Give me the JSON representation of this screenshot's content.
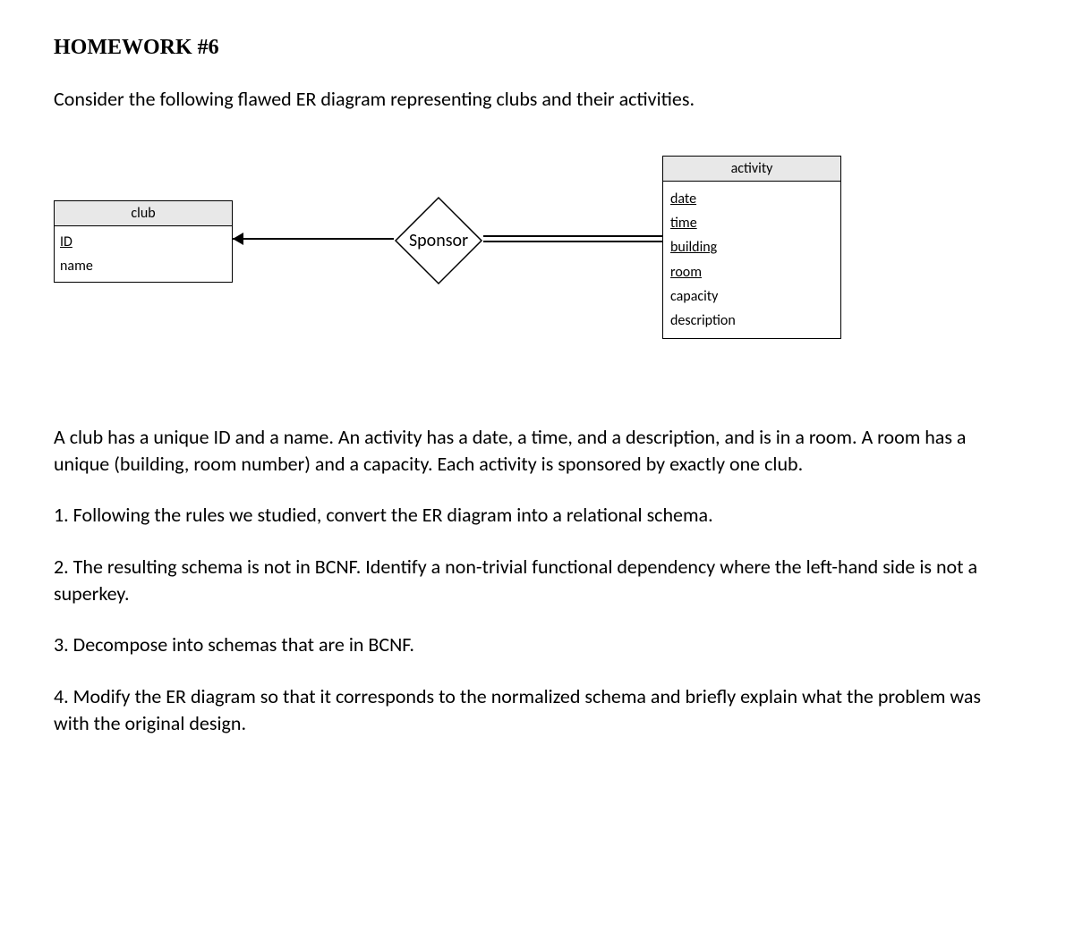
{
  "title": "HOMEWORK #6",
  "intro": "Consider the following flawed ER diagram representing clubs and their activities.",
  "diagram": {
    "club": {
      "header": "club",
      "attrs": {
        "id": "ID",
        "name": "name"
      }
    },
    "relationship": "Sponsor",
    "activity": {
      "header": "activity",
      "attrs": {
        "date": "date",
        "time": "time",
        "building": "building",
        "room": "room",
        "capacity": "capacity",
        "description": "description"
      }
    }
  },
  "description_para": "A club has a unique ID and a name. An activity has a date, a time, and a description, and is in a room. A room has a unique (building, room number) and a capacity. Each activity is sponsored by exactly one club.",
  "questions": {
    "q1": "1. Following the rules we studied, convert the ER diagram into a relational schema.",
    "q2": "2. The resulting schema is not in BCNF. Identify a non-trivial functional dependency where the left-hand side is not a superkey.",
    "q3": "3. Decompose into schemas that are in BCNF.",
    "q4": "4. Modify the ER diagram so that it corresponds to the normalized schema and briefly explain what the problem was with the original design."
  }
}
